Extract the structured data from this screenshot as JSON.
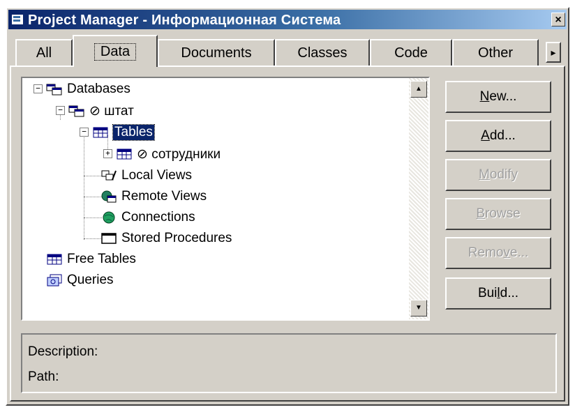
{
  "window": {
    "title": "Project Manager - Информационная Система",
    "close_glyph": "×"
  },
  "tabs": [
    {
      "label": "All"
    },
    {
      "label": "Data",
      "active": true
    },
    {
      "label": "Documents"
    },
    {
      "label": "Classes"
    },
    {
      "label": "Code"
    },
    {
      "label": "Other"
    }
  ],
  "tab_scroll_glyph": "▸",
  "tree": {
    "nodes": [
      {
        "label": "Databases",
        "icon": "databases-icon",
        "expander": "−"
      },
      {
        "label": "⊘ штат",
        "icon": "database-icon",
        "expander": "−"
      },
      {
        "label": "Tables",
        "icon": "table-icon",
        "expander": "−",
        "selected": true
      },
      {
        "label": "⊘ сотрудники",
        "icon": "table-icon",
        "expander": "+"
      },
      {
        "label": "Local Views",
        "icon": "local-views-icon"
      },
      {
        "label": "Remote Views",
        "icon": "remote-views-icon"
      },
      {
        "label": "Connections",
        "icon": "connections-icon"
      },
      {
        "label": "Stored Procedures",
        "icon": "stored-procedures-icon"
      },
      {
        "label": "Free Tables",
        "icon": "free-tables-icon"
      },
      {
        "label": "Queries",
        "icon": "queries-icon"
      }
    ]
  },
  "scrollbar": {
    "up": "▲",
    "down": "▼"
  },
  "buttons": {
    "new": {
      "pre": "",
      "mnemonic": "N",
      "post": "ew...",
      "enabled": true
    },
    "add": {
      "pre": "",
      "mnemonic": "A",
      "post": "dd...",
      "enabled": true
    },
    "modify": {
      "pre": "",
      "mnemonic": "M",
      "post": "odify",
      "enabled": false
    },
    "browse": {
      "pre": "",
      "mnemonic": "B",
      "post": "rowse",
      "enabled": false
    },
    "remove": {
      "pre": "Remo",
      "mnemonic": "v",
      "post": "e...",
      "enabled": false
    },
    "build": {
      "pre": "Bui",
      "mnemonic": "l",
      "post": "d...",
      "enabled": true
    }
  },
  "info": {
    "description_label": "Description:",
    "path_label": "Path:"
  }
}
